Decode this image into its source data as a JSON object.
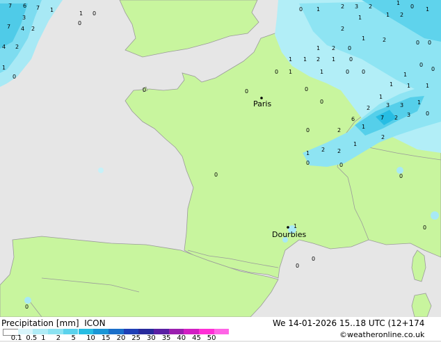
{
  "map": {
    "cities": [
      {
        "name": "Paris"
      },
      {
        "name": "Dourbies"
      }
    ]
  },
  "footer": {
    "left_title": "Precipitation [mm]",
    "model": "ICON",
    "datetime": "We 14-01-2026 15..18 UTC (12+174",
    "credit": "©weatheronline.co.uk",
    "scale_labels": [
      "0.1",
      "0.5",
      "1",
      "2",
      "5",
      "10",
      "15",
      "20",
      "25",
      "30",
      "35",
      "40",
      "45",
      "50"
    ],
    "scale_colors": [
      "#ffffff",
      "#d9f5fb",
      "#b0ecf6",
      "#8de3f2",
      "#5bd2ec",
      "#27bde3",
      "#1a96d6",
      "#1a6fca",
      "#1f3fb6",
      "#282a9c",
      "#5a1fa3",
      "#9a1faf",
      "#d21fc3",
      "#ff2fd6",
      "#ff64e6"
    ]
  }
}
